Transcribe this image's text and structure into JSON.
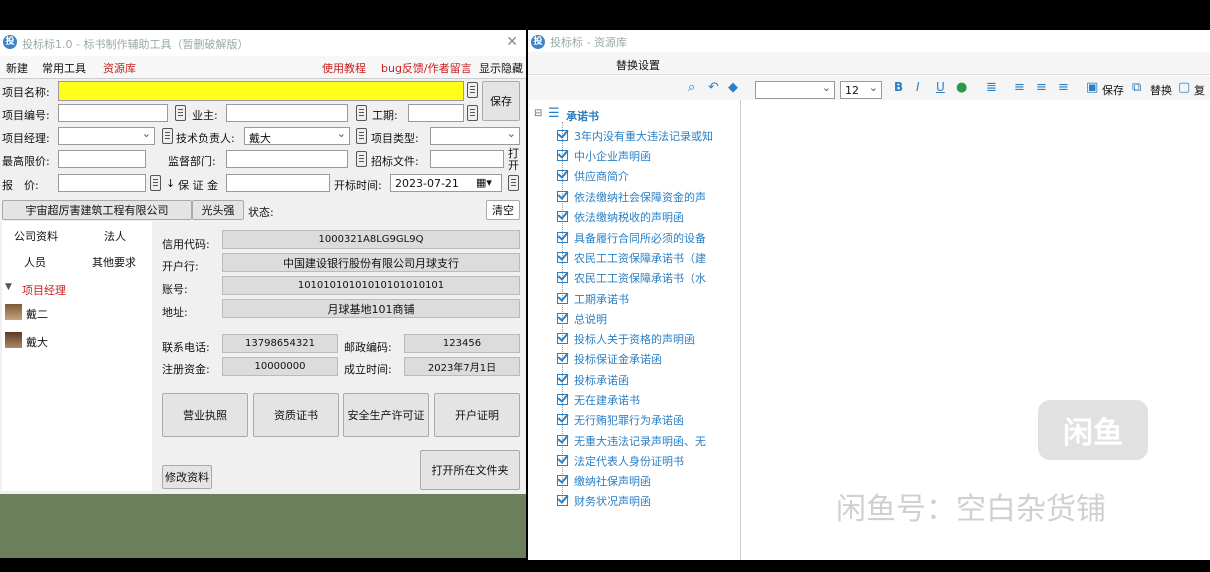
{
  "left_window": {
    "title": "投标标1.0 - 标书制作辅助工具（暂删破解版）",
    "menu": {
      "new": "新建",
      "common_tools": "常用工具",
      "resource_lib": "资源库",
      "tutorial": "使用教程",
      "bug_feedback": "bug反馈/作者留言",
      "show_hide": "显示隐藏"
    },
    "form": {
      "project_name_label": "项目名称:",
      "project_name_value": "",
      "project_no_label": "项目编号:",
      "owner_label": "业主:",
      "period_label": "工期:",
      "manager_label": "项目经理:",
      "tech_lead_label": "技术负责人:",
      "tech_lead_value": "戴大",
      "project_type_label": "项目类型:",
      "max_price_label": "最高限价:",
      "supervisor_label": "监督部门:",
      "tender_doc_label": "招标文件:",
      "open_label": "打开",
      "quote_label": "报　价:",
      "deposit_label": "保 证 金",
      "deposit_arrow": "↓",
      "open_time_label": "开标时间:",
      "open_time_value": "2023-07-21",
      "save_button": "保存"
    },
    "status_row": {
      "company": "宇宙超厉害建筑工程有限公司",
      "nickname": "光头强",
      "status_label": "状态:",
      "clear_button": "清空"
    },
    "nav": {
      "company_info": "公司资料",
      "legal_person": "法人",
      "personnel": "人员",
      "other_requirements": "其他要求",
      "group": "项目经理",
      "persons": [
        "戴二",
        "戴大"
      ]
    },
    "details": {
      "credit_code_label": "信用代码:",
      "credit_code": "1000321A8LG9GL9Q",
      "bank_label": "开户行:",
      "bank": "中国建设银行股份有限公司月球支行",
      "account_label": "账号:",
      "account": "10101010101010101010101",
      "address_label": "地址:",
      "address": "月球基地101商铺",
      "phone_label": "联系电话:",
      "phone": "13798654321",
      "postcode_label": "邮政编码:",
      "postcode": "123456",
      "capital_label": "注册资金:",
      "capital": "10000000",
      "founded_label": "成立时间:",
      "founded": "2023年7月1日",
      "btn_license": "营业执照",
      "btn_qualification": "资质证书",
      "btn_safety": "安全生产许可证",
      "btn_account": "开户证明",
      "btn_edit": "修改资料",
      "btn_open_folder": "打开所在文件夹"
    }
  },
  "right_window": {
    "title": "投标标 - 资源库",
    "menu_replace_settings": "替换设置",
    "toolbar": {
      "font_size": "12",
      "bold": "B",
      "italic": "I",
      "underline": "U",
      "save": "保存",
      "replace": "替换",
      "more": "复"
    },
    "tree_root": "承诺书",
    "tree_items": [
      "3年内没有重大违法记录或知",
      "中小企业声明函",
      "供应商简介",
      "依法缴纳社会保障资金的声",
      "依法缴纳税收的声明函",
      "具备履行合同所必须的设备",
      "农民工工资保障承诺书（建",
      "农民工工资保障承诺书（水",
      "工期承诺书",
      "总说明",
      "投标人关于资格的声明函",
      "投标保证金承诺函",
      "投标承诺函",
      "无在建承诺书",
      "无行贿犯罪行为承诺函",
      "无重大违法记录声明函、无",
      "法定代表人身份证明书",
      "缴纳社保声明函",
      "财务状况声明函"
    ]
  },
  "watermark": {
    "logo_text": "闲鱼",
    "text": "闲鱼号：空白杂货铺"
  }
}
